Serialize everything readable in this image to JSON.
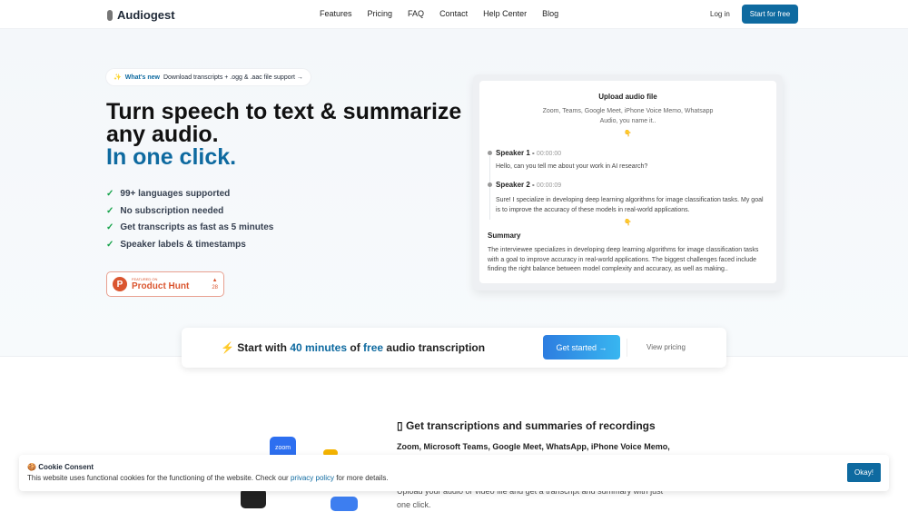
{
  "nav": {
    "brand": "Audiogest",
    "links": [
      "Features",
      "Pricing",
      "FAQ",
      "Contact",
      "Help Center",
      "Blog"
    ],
    "login": "Log in",
    "start": "Start for free"
  },
  "hero": {
    "pill_icon": "✨",
    "pill_label": "What's new",
    "pill_text": "Download transcripts + .ogg & .aac file support →",
    "title1": "Turn speech to text & summarize",
    "title2": "any audio.",
    "title3": "In one click.",
    "features": [
      "99+ languages supported",
      "No subscription needed",
      "Get transcripts as fast as 5 minutes",
      "Speaker labels & timestamps"
    ],
    "ph": {
      "featured": "FEATURED ON",
      "name": "Product Hunt",
      "votes": "28"
    }
  },
  "card": {
    "title": "Upload audio file",
    "subtitle": "Zoom, Teams, Google Meet, iPhone Voice Memo, Whatsapp Audio, you name it..",
    "hand": "👇",
    "s1": {
      "name": "Speaker 1",
      "time": "00:00:00",
      "text": "Hello, can you tell me about your work in AI research?"
    },
    "s2": {
      "name": "Speaker 2",
      "time": "00:00:09",
      "text": "Sure! I specialize in developing deep learning algorithms for image classification tasks. My goal is to improve the accuracy of these models in real-world applications."
    },
    "summary_title": "Summary",
    "summary": "The interviewee specializes in developing deep learning algorithms for image classification tasks with a goal to improve accuracy in real-world applications. The biggest challenges faced include finding the right balance between model complexity and accuracy, as well as making.."
  },
  "cta": {
    "icon": "⚡",
    "t1": "Start with",
    "t2": "40 minutes",
    "t3": "of",
    "t4": "free",
    "t5": "audio transcription",
    "button": "Get started →",
    "pricing": "View pricing"
  },
  "section": {
    "icon": "▯",
    "title": "Get transcriptions and summaries of recordings",
    "sub": "Zoom, Microsoft Teams, Google Meet, WhatsApp, iPhone Voice Memo,",
    "para": "Upload your audio or video file and get a transcript and summary with just one click.",
    "zoom_label": "zoom"
  },
  "cookie": {
    "icon": "🍪",
    "title": "Cookie Consent",
    "text1": "This website uses functional cookies for the functioning of the website. Check our",
    "link": "privacy policy",
    "text2": "for more details.",
    "ok": "Okay!"
  }
}
